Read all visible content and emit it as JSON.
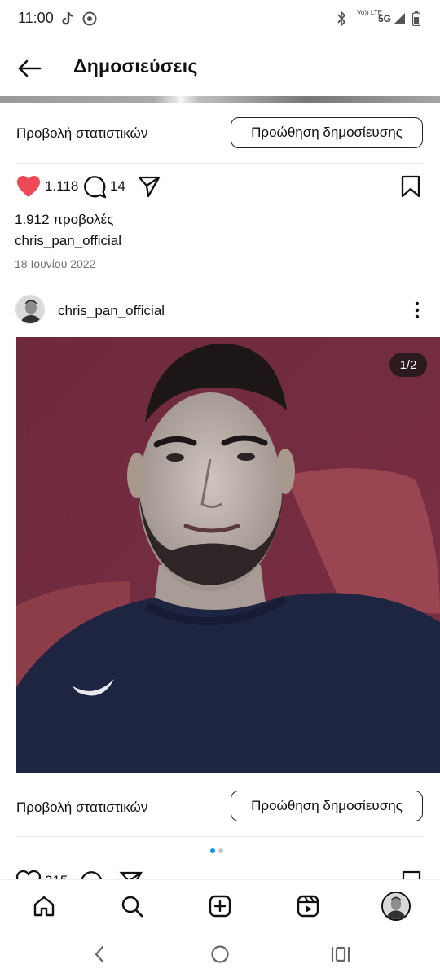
{
  "status_bar": {
    "time": "11:00",
    "network_labels": [
      "Vo)) LTE",
      "5G"
    ]
  },
  "header": {
    "title": "Δημοσιεύσεις",
    "back_icon": "arrow-left-icon"
  },
  "post1": {
    "insights_label": "Προβολή στατιστικών",
    "promote_label": "Προώθηση δημοσίευσης",
    "likes": "1.118",
    "comments": "14",
    "views": "1.912 προβολές",
    "caption_user": "chris_pan_official",
    "date": "18 Ιουνίου 2022",
    "liked_color": "#ed4956"
  },
  "post2": {
    "username": "chris_pan_official",
    "photo_counter": "1/2",
    "insights_label": "Προβολή στατιστικών",
    "promote_label": "Προώθηση δημοσίευσης",
    "likes_partial": "215",
    "carousel_active_color": "#0095f6",
    "carousel_inactive_color": "#c7c7c7"
  },
  "bottom_nav": {
    "items": [
      "home-icon",
      "search-icon",
      "create-icon",
      "reels-icon",
      "profile-avatar"
    ]
  },
  "system_nav": {
    "items": [
      "back-icon",
      "home-circle-icon",
      "recents-icon"
    ]
  }
}
